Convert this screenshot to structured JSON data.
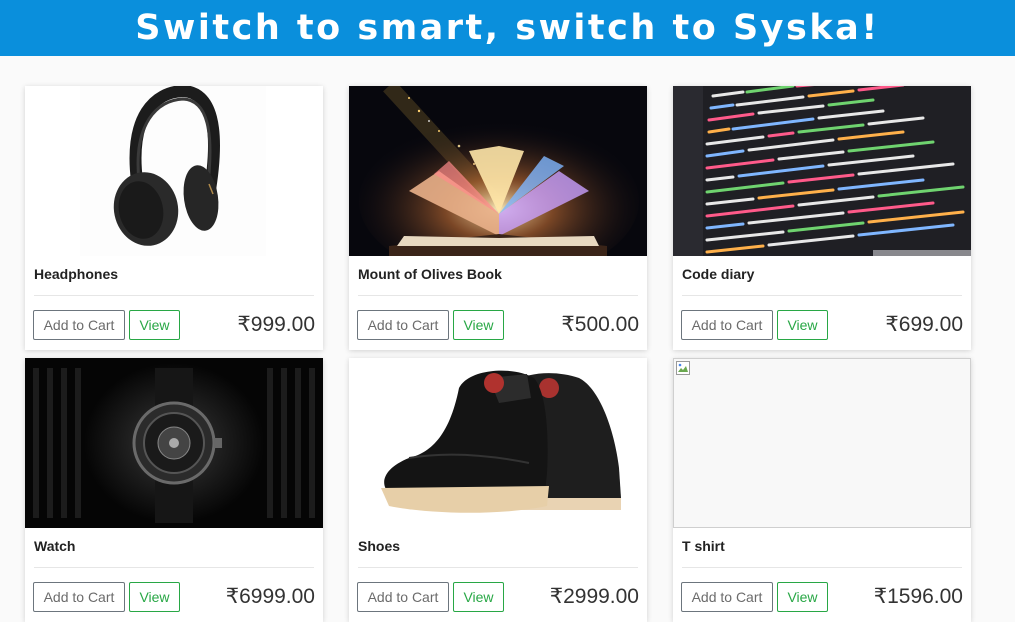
{
  "banner": {
    "text": "Switch to smart, switch to Syska!",
    "color": "#0a8fdc"
  },
  "products": [
    {
      "name": "Headphones",
      "price": "₹999.00",
      "image": "headphones-image",
      "cart_label": "Add to Cart",
      "view_label": "View"
    },
    {
      "name": "Mount of Olives Book",
      "price": "₹500.00",
      "image": "glowing-book-image",
      "cart_label": "Add to Cart",
      "view_label": "View"
    },
    {
      "name": "Code diary",
      "price": "₹699.00",
      "image": "code-screen-image",
      "cart_label": "Add to Cart",
      "view_label": "View"
    },
    {
      "name": "Watch",
      "price": "₹6999.00",
      "image": "watch-image",
      "cart_label": "Add to Cart",
      "view_label": "View"
    },
    {
      "name": "Shoes",
      "price": "₹2999.00",
      "image": "sneakers-image",
      "cart_label": "Add to Cart",
      "view_label": "View"
    },
    {
      "name": "T shirt",
      "price": "₹1596.00",
      "image": "broken-image-icon",
      "cart_label": "Add to Cart",
      "view_label": "View"
    }
  ],
  "colors": {
    "view_green": "#28a745",
    "cart_gray": "#6c757d"
  }
}
